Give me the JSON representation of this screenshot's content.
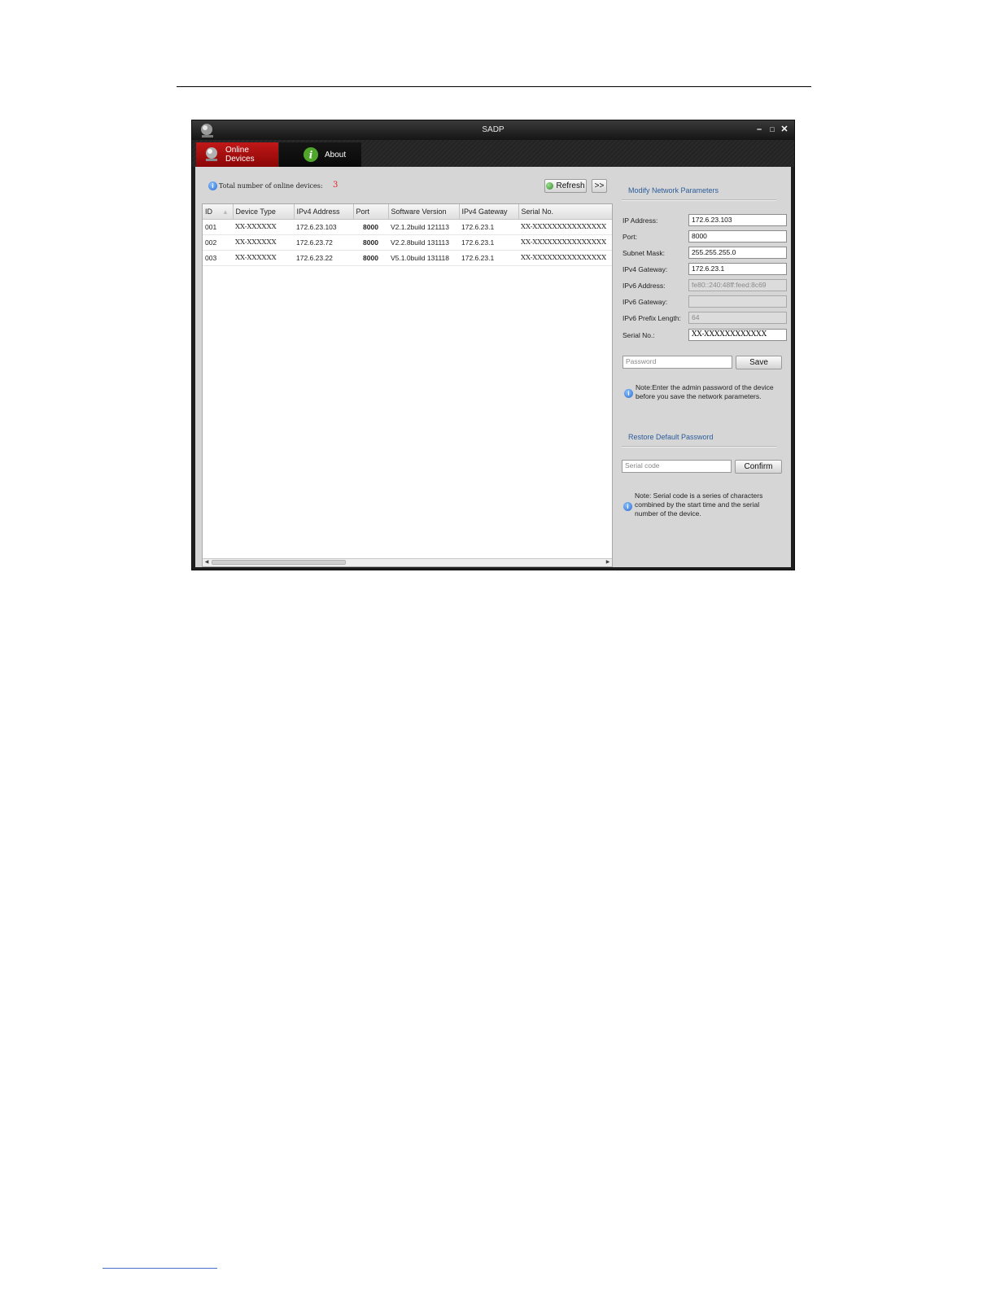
{
  "window": {
    "title": "SADP"
  },
  "tabs": [
    {
      "label": "Online Devices",
      "active": true,
      "icon": "device-camera-icon"
    },
    {
      "label": "About",
      "active": false,
      "icon": "info-icon"
    }
  ],
  "toolbar": {
    "total_label": "Total number of online devices:",
    "total_count": "3",
    "refresh_label": "Refresh",
    "expand_label": ">>"
  },
  "table": {
    "columns": [
      "ID",
      "Device Type",
      "IPv4 Address",
      "Port",
      "Software Version",
      "IPv4 Gateway",
      "Serial No."
    ],
    "rows": [
      {
        "id": "001",
        "type": "XX-XXXXXX",
        "ip": "172.6.23.103",
        "port": "8000",
        "version": "V2.1.2build 121113",
        "gateway": "172.6.23.1",
        "serial": "XX-XXXXXXXXXXXXXXX"
      },
      {
        "id": "002",
        "type": "XX-XXXXXX",
        "ip": "172.6.23.72",
        "port": "8000",
        "version": "V2.2.8build 131113",
        "gateway": "172.6.23.1",
        "serial": "XX-XXXXXXXXXXXXXXX"
      },
      {
        "id": "003",
        "type": "XX-XXXXXX",
        "ip": "172.6.23.22",
        "port": "8000",
        "version": "V5.1.0build 131118",
        "gateway": "172.6.23.1",
        "serial": "XX-XXXXXXXXXXXXXXX"
      }
    ]
  },
  "network_panel": {
    "heading": "Modify Network Parameters",
    "fields": [
      {
        "label": "IP Address:",
        "value": "172.6.23.103",
        "enabled": true
      },
      {
        "label": "Port:",
        "value": "8000",
        "enabled": true
      },
      {
        "label": "Subnet Mask:",
        "value": "255.255.255.0",
        "enabled": true
      },
      {
        "label": "IPv4 Gateway:",
        "value": "172.6.23.1",
        "enabled": true
      },
      {
        "label": "IPv6 Address:",
        "value": "fe80::240:48ff:feed:8c69",
        "enabled": false
      },
      {
        "label": "IPv6 Gateway:",
        "value": "",
        "enabled": false
      },
      {
        "label": "IPv6 Prefix Length:",
        "value": "64",
        "enabled": false
      },
      {
        "label": "Serial No.:",
        "value": "XX-XXXXXXXXXXXX",
        "enabled": true
      }
    ],
    "password_placeholder": "Password",
    "save_label": "Save",
    "note_line1": "Note:Enter the admin password of the device",
    "note_line2": "before you save the network parameters."
  },
  "restore_panel": {
    "heading": "Restore Default Password",
    "serial_placeholder": "Serial code",
    "confirm_label": "Confirm",
    "note_line1": "Note: Serial code is a series of characters",
    "note_line2": "combined by the start time and the serial",
    "note_line3": "number of the device."
  }
}
